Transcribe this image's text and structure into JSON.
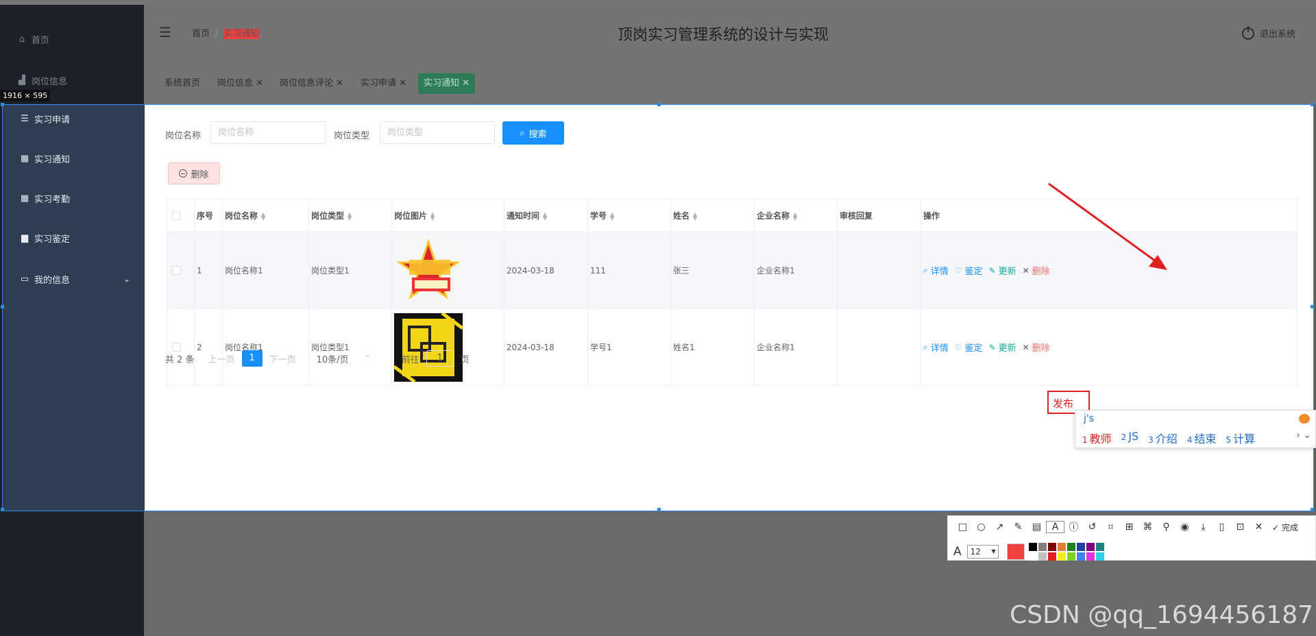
{
  "sidebar": {
    "items": [
      {
        "label": "首页",
        "icon": "home-icon"
      },
      {
        "label": "岗位信息",
        "icon": "briefcase-icon"
      },
      {
        "label": "实习申请",
        "icon": "list-icon"
      },
      {
        "label": "实习通知",
        "icon": "grid-icon"
      },
      {
        "label": "实习考勤",
        "icon": "grid-icon"
      },
      {
        "label": "实习鉴定",
        "icon": "case-icon"
      },
      {
        "label": "我的信息",
        "icon": "card-icon"
      }
    ]
  },
  "header": {
    "breadcrumb_home": "首页",
    "breadcrumb_current": "实习通知",
    "title": "顶岗实习管理系统的设计与实现",
    "logout": "退出系统"
  },
  "tabs": [
    {
      "label": "系统首页"
    },
    {
      "label": "岗位信息"
    },
    {
      "label": "岗位信息评论"
    },
    {
      "label": "实习申请"
    },
    {
      "label": "实习通知"
    }
  ],
  "capture": {
    "size_label": "1916 × 595"
  },
  "search": {
    "name_label": "岗位名称",
    "name_placeholder": "岗位名称",
    "type_label": "岗位类型",
    "type_placeholder": "岗位类型",
    "button": "搜索"
  },
  "toolbar": {
    "delete": "删除"
  },
  "table": {
    "headers": [
      "序号",
      "岗位名称",
      "岗位类型",
      "岗位图片",
      "通知时间",
      "学号",
      "姓名",
      "企业名称",
      "审核回复",
      "操作"
    ],
    "rows": [
      {
        "index": "1",
        "name": "岗位名称1",
        "type": "岗位类型1",
        "time": "2024-03-18",
        "student_no": "111",
        "student_name": "张三",
        "company": "企业名称1",
        "reply": ""
      },
      {
        "index": "2",
        "name": "岗位名称1",
        "type": "岗位类型1",
        "time": "2024-03-18",
        "student_no": "学号1",
        "student_name": "姓名1",
        "company": "企业名称1",
        "reply": ""
      }
    ],
    "ops": {
      "detail": "详情",
      "appraise": "鉴定",
      "update": "更新",
      "delete": "删除"
    }
  },
  "pagination": {
    "total": "共 2 条",
    "prev": "上一页",
    "page": "1",
    "next": "下一页",
    "size": "10条/页",
    "goto_label": "前往",
    "goto_value": "1",
    "goto_unit": "页"
  },
  "annotation": {
    "text": "发布"
  },
  "ime": {
    "composition": "j's",
    "candidates": [
      {
        "n": "1",
        "text": "教师"
      },
      {
        "n": "2",
        "text": "JS"
      },
      {
        "n": "3",
        "text": "介绍"
      },
      {
        "n": "4",
        "text": "结束"
      },
      {
        "n": "5",
        "text": "计算"
      }
    ]
  },
  "screenshot_toolbar": {
    "done": "完成",
    "font_size": "12",
    "current_color": "#f04040",
    "palette": [
      "#000000",
      "#808080",
      "#800000",
      "#e08030",
      "#208020",
      "#2040a0",
      "#800080",
      "#208080",
      "#ffffff",
      "#c0c0c0",
      "#e02020",
      "#f0f020",
      "#80d020",
      "#4080f0",
      "#e030e0",
      "#30d0e0"
    ]
  },
  "watermark": "CSDN @qq_1694456187",
  "colors": {
    "primary": "#1890ff",
    "success": "#13a89e",
    "danger": "#f56c6c",
    "sidebar": "#2d3e53"
  }
}
